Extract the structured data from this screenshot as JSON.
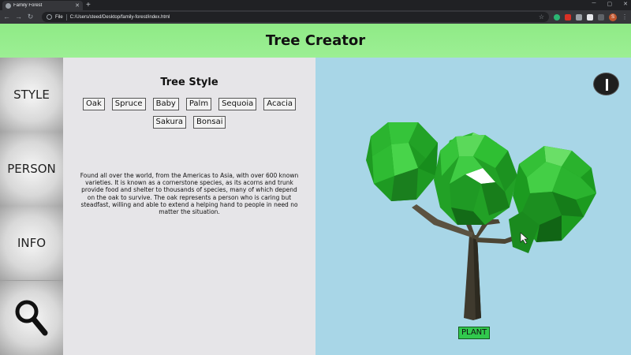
{
  "browser": {
    "tab_title": "Family Forest",
    "url_scheme": "File",
    "url": "C:/Users/steed/Desktop/family-forest/index.html",
    "profile_initial": "S"
  },
  "app": {
    "title": "Tree Creator"
  },
  "nav": {
    "style": "STYLE",
    "person": "PERSON",
    "info": "INFO",
    "search_icon": "search-icon"
  },
  "panel": {
    "title": "Tree Style",
    "styles": [
      "Oak",
      "Spruce",
      "Baby",
      "Palm",
      "Sequoia",
      "Acacia",
      "Sakura",
      "Bonsai"
    ],
    "description": "Found all over the world, from the Americas to Asia, with over 600 known varieties. It is known as a cornerstone species, as its acorns and trunk provide food and shelter to thousands of species, many of which depend on the oak to survive. The oak represents a person who is caring but steadfast, willing and able to extend a helping hand to people in need no matter the situation."
  },
  "scene": {
    "plant_label": "PLANT",
    "info_icon": "info-icon"
  },
  "colors": {
    "header_green": "#96ed8d",
    "sky": "#a8d6e7",
    "plant_button": "#31c94d"
  }
}
